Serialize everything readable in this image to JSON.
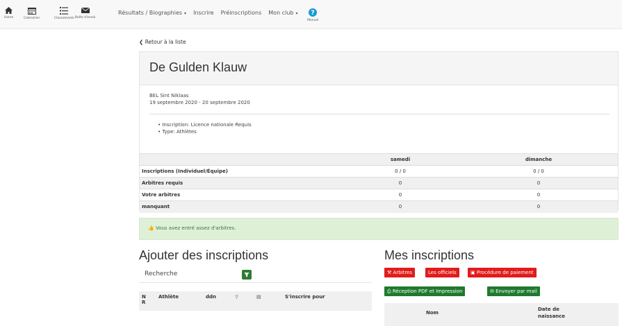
{
  "nav": {
    "icons": [
      {
        "label": "Home",
        "icon": "home-icon"
      },
      {
        "label": "Calendrier",
        "icon": "calendar-icon"
      },
      {
        "label": "Classements",
        "icon": "list-icon"
      },
      {
        "label": "Boîte d'envoi",
        "icon": "envelope-icon"
      }
    ],
    "menu": [
      "Résultats / Biographies",
      "Inscrire",
      "Préinscriptions",
      "Mon club"
    ],
    "help_label": "Manuel"
  },
  "back_label": "Retour à la liste",
  "competition": {
    "title": "De Gulden Klauw",
    "location": "BEL Sint Niklaas",
    "dates": "19 septembre 2020 - 20 septembre 2020",
    "bullets": [
      "Inscription: Licence nationale Requis",
      "Type: Athlètes"
    ]
  },
  "counts": {
    "columns": [
      "samedi",
      "dimanche"
    ],
    "rows": [
      {
        "label": "Inscriptions (Individuel/Équipe)",
        "values": [
          "0 / 0",
          "0 / 0"
        ]
      },
      {
        "label": "Arbitres requis",
        "values": [
          "0",
          "0"
        ]
      },
      {
        "label": "Votre arbitres",
        "values": [
          "0",
          "0"
        ]
      },
      {
        "label": "manquant",
        "values": [
          "0",
          "0"
        ]
      }
    ]
  },
  "alert": "Vous avez entré assez d'arbitres.",
  "add": {
    "title": "Ajouter des inscriptions",
    "search_label": "Recherche",
    "columns": [
      "N R",
      "Athlète",
      "ddn",
      "⚲",
      "▤",
      "S'inscrire pour"
    ]
  },
  "mine": {
    "title": "Mes inscriptions",
    "buttons_row1": [
      "Arbitres",
      "Les officiels",
      "Procédure de paiement"
    ],
    "buttons_row2": [
      "Réception PDF et Impression",
      "Envoyer par mail"
    ],
    "columns": [
      "Nom",
      "Date de naissance"
    ]
  }
}
